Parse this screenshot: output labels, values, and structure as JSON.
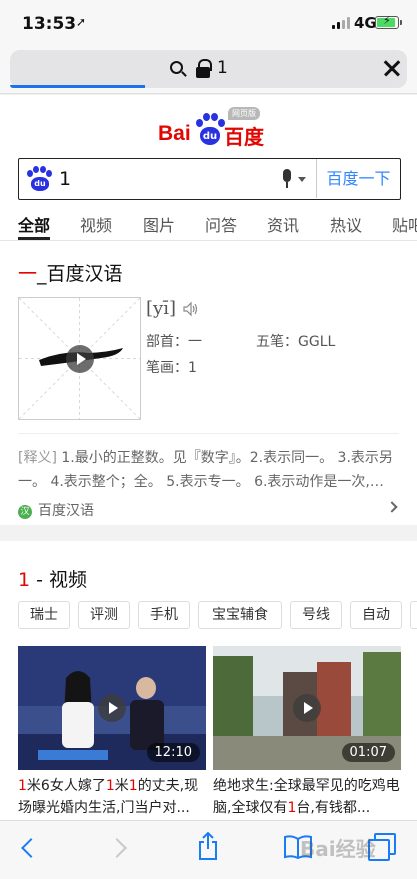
{
  "status_bar": {
    "time": "13:53",
    "network": "4G"
  },
  "address_bar": {
    "url_text": "1"
  },
  "logo": {
    "text_en": "Bai",
    "paw_text": "du",
    "text_cn": "百度",
    "badge": "网页版"
  },
  "search": {
    "query": "1",
    "button_label": "百度一下"
  },
  "tabs": [
    "全部",
    "视频",
    "图片",
    "问答",
    "资讯",
    "热议",
    "贴吧"
  ],
  "dict_card": {
    "title_char": "一",
    "title_rest": "_百度汉语",
    "pinyin": "[yī]",
    "bushou": "部首：一",
    "wubi": "五笔：GGLL",
    "bihua": "笔画：1",
    "definition_tag": "[释义]",
    "definition": " 1.最小的正整数。见『数字』。2.表示同一。 3.表示另一。 4.表示整个；全。 5.表示专一。 6.表示动作是一次,…",
    "source_icon": "汉",
    "source": "百度汉语"
  },
  "video_card": {
    "title_num": "1",
    "title_rest": " - 视频",
    "chips": [
      "瑞士",
      "评测",
      "手机",
      "宝宝辅食",
      "号线",
      "自动"
    ],
    "videos": [
      {
        "duration": "12:10",
        "title_parts": [
          "1",
          "米6女人嫁了",
          "1",
          "米",
          "1",
          "的丈夫,现场曝光婚内生活,门当户对..."
        ]
      },
      {
        "duration": "01:07",
        "title_a": "绝地求生:全球最罕见的吃鸡电脑,全球仅有",
        "title_num": "1",
        "title_b": "台,有钱都..."
      }
    ]
  },
  "toolbar": {
    "watermark": "Bai经验"
  }
}
